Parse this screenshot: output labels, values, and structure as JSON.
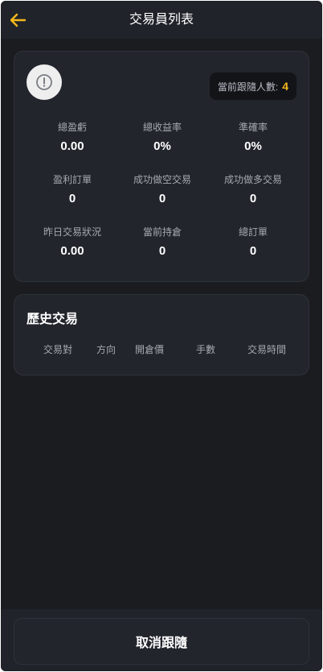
{
  "colors": {
    "background": "#1b1c20",
    "header": "#202329",
    "card": "#22252c",
    "accent": "#f5b81c",
    "text_primary": "#ffffff",
    "text_secondary": "#a6a9b0"
  },
  "header": {
    "back_icon": "arrow-left-icon",
    "title": "交易員列表"
  },
  "profile": {
    "avatar_icon": "exclamation-circle-icon",
    "followers_label": "當前跟隨人數:",
    "followers_count": "4"
  },
  "stats": [
    {
      "label": "總盈虧",
      "value": "0.00"
    },
    {
      "label": "總收益率",
      "value": "0%"
    },
    {
      "label": "準確率",
      "value": "0%"
    },
    {
      "label": "盈利訂單",
      "value": "0"
    },
    {
      "label": "成功做空交易",
      "value": "0"
    },
    {
      "label": "成功做多交易",
      "value": "0"
    },
    {
      "label": "昨日交易狀況",
      "value": "0.00"
    },
    {
      "label": "當前持倉",
      "value": "0"
    },
    {
      "label": "總訂單",
      "value": "0"
    }
  ],
  "history": {
    "title": "歷史交易",
    "columns": [
      "交易對",
      "方向",
      "開倉價",
      "手數",
      "交易時間"
    ]
  },
  "footer": {
    "cancel_label": "取消跟隨"
  }
}
